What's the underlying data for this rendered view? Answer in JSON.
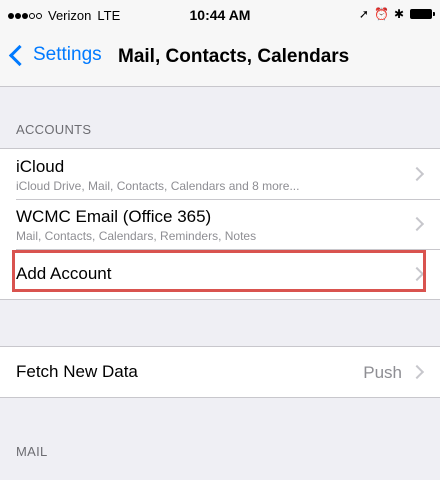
{
  "status_bar": {
    "carrier": "Verizon",
    "network": "LTE",
    "time": "10:44 AM"
  },
  "nav": {
    "back_label": "Settings",
    "title": "Mail, Contacts, Calendars"
  },
  "sections": {
    "accounts_header": "ACCOUNTS",
    "mail_header": "MAIL"
  },
  "accounts": [
    {
      "title": "iCloud",
      "subtitle": "iCloud Drive, Mail, Contacts, Calendars and 8 more..."
    },
    {
      "title": "WCMC Email (Office 365)",
      "subtitle": "Mail, Contacts, Calendars, Reminders, Notes"
    },
    {
      "title": "Add Account"
    }
  ],
  "fetch": {
    "title": "Fetch New Data",
    "value": "Push"
  },
  "highlight_color": "#d9534f",
  "accent_color": "#007aff"
}
